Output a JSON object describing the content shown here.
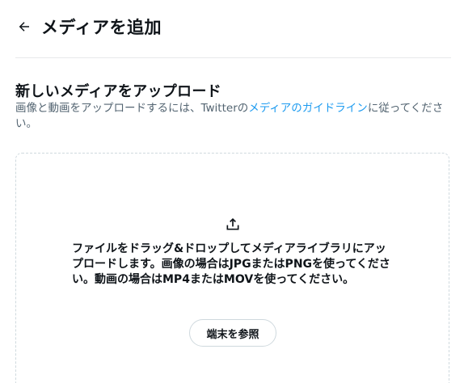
{
  "header": {
    "title": "メディアを追加",
    "back_icon": "arrow-left-icon"
  },
  "upload_section": {
    "title": "新しいメディアをアップロード",
    "description_before": "画像と動画をアップロードするには、Twitterの",
    "guidelines_link": "メディアのガイドライン",
    "description_after": "に従ってください。"
  },
  "dropzone": {
    "icon": "upload-icon",
    "instructions": "ファイルをドラッグ&ドロップしてメディアライブラリにアップロードします。画像の場合はJPGまたはPNGを使ってください。動画の場合はMP4またはMOVを使ってください。",
    "browse_button": "端末を参照"
  },
  "colors": {
    "text": "#0f1419",
    "secondary_text": "#536471",
    "link": "#1d9bf0",
    "border": "#cfd9de",
    "divider": "#e7e9ea"
  }
}
